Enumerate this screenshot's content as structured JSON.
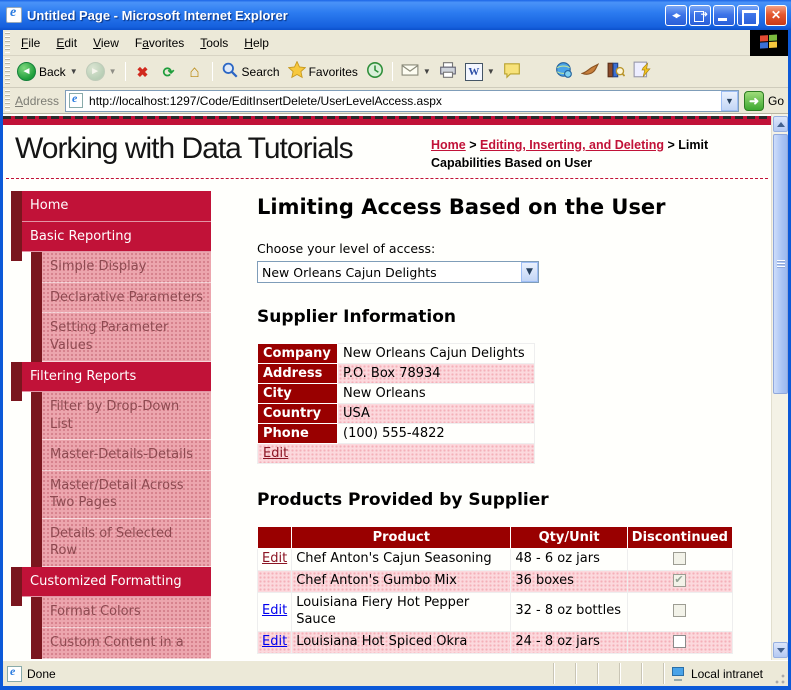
{
  "window": {
    "title": "Untitled Page - Microsoft Internet Explorer"
  },
  "menu_bar": {
    "items": [
      {
        "label": "File",
        "accel": 0
      },
      {
        "label": "Edit",
        "accel": 0
      },
      {
        "label": "View",
        "accel": 0
      },
      {
        "label": "Favorites",
        "accel": 1
      },
      {
        "label": "Tools",
        "accel": 0
      },
      {
        "label": "Help",
        "accel": 0
      }
    ]
  },
  "toolbar": {
    "buttons": [
      {
        "icon": "back-icon",
        "label": "Back",
        "dropdown": true
      },
      {
        "icon": "forward-icon",
        "label": "",
        "dropdown": true,
        "disabled": true
      },
      {
        "sep": true
      },
      {
        "icon": "stop-icon"
      },
      {
        "icon": "refresh-icon"
      },
      {
        "icon": "home-icon"
      },
      {
        "sep": true
      },
      {
        "icon": "search-icon",
        "label": "Search"
      },
      {
        "icon": "favorites-star-icon",
        "label": "Favorites"
      },
      {
        "icon": "history-icon"
      },
      {
        "sep": true
      },
      {
        "icon": "mail-icon",
        "dropdown": true
      },
      {
        "icon": "print-icon"
      },
      {
        "icon": "edit-word-icon",
        "dropdown": true
      },
      {
        "icon": "discuss-icon"
      },
      {
        "gap": true
      },
      {
        "icon": "research-globe-icon"
      },
      {
        "icon": "fox-icon"
      },
      {
        "icon": "library-search-icon"
      },
      {
        "icon": "messenger-grid-icon"
      }
    ]
  },
  "address_bar": {
    "label": "Address",
    "url": "http://localhost:1297/Code/EditInsertDelete/UserLevelAccess.aspx",
    "go_label": "Go"
  },
  "page": {
    "site_title": "Working with Data Tutorials",
    "breadcrumb": [
      {
        "label": "Home",
        "link": true
      },
      {
        "label": "Editing, Inserting, and Deleting",
        "link": true
      },
      {
        "label": "Limit Capabilities Based on User",
        "link": false
      }
    ],
    "sidebar": [
      {
        "label": "Home",
        "level": 0
      },
      {
        "label": "Basic Reporting",
        "level": 0
      },
      {
        "label": "Simple Display",
        "level": 1
      },
      {
        "label": "Declarative Parameters",
        "level": 1
      },
      {
        "label": "Setting Parameter Values",
        "level": 1
      },
      {
        "label": "Filtering Reports",
        "level": 0
      },
      {
        "label": "Filter by Drop-Down List",
        "level": 1
      },
      {
        "label": "Master-Details-Details",
        "level": 1
      },
      {
        "label": "Master/Detail Across Two Pages",
        "level": 1
      },
      {
        "label": "Details of Selected Row",
        "level": 1
      },
      {
        "label": "Customized Formatting",
        "level": 0
      },
      {
        "label": "Format Colors",
        "level": 1
      },
      {
        "label": "Custom Content in a",
        "level": 1
      }
    ],
    "heading": "Limiting Access Based on the User",
    "access_prompt": "Choose your level of access:",
    "access_selected": "New Orleans Cajun Delights",
    "supplier": {
      "heading": "Supplier Information",
      "fields": [
        {
          "label": "Company",
          "value": "New Orleans Cajun Delights"
        },
        {
          "label": "Address",
          "value": "P.O. Box 78934"
        },
        {
          "label": "City",
          "value": "New Orleans"
        },
        {
          "label": "Country",
          "value": "USA"
        },
        {
          "label": "Phone",
          "value": "(100) 555-4822"
        }
      ],
      "edit_label": "Edit"
    },
    "products": {
      "heading": "Products Provided by Supplier",
      "columns": [
        "",
        "Product",
        "Qty/Unit",
        "Discontinued"
      ],
      "rows": [
        {
          "edit": "Edit",
          "edit_color": "maroon",
          "product": "Chef Anton's Cajun Seasoning",
          "qty": "48 - 6 oz jars",
          "discontinued": false,
          "checkbox_disabled": true
        },
        {
          "edit": null,
          "edit_color": null,
          "product": "Chef Anton's Gumbo Mix",
          "qty": "36 boxes",
          "discontinued": true,
          "checkbox_disabled": true
        },
        {
          "edit": "Edit",
          "edit_color": "blue",
          "product": "Louisiana Fiery Hot Pepper Sauce",
          "qty": "32 - 8 oz bottles",
          "discontinued": false,
          "checkbox_disabled": true
        },
        {
          "edit": "Edit",
          "edit_color": "blue",
          "product": "Louisiana Hot Spiced Okra",
          "qty": "24 - 8 oz jars",
          "discontinued": false,
          "checkbox_disabled": false
        }
      ]
    }
  },
  "status_bar": {
    "left": "Done",
    "right": "Local intranet"
  },
  "colors": {
    "accent_red": "#C11238",
    "dark_red_bar": "#7A161E",
    "sidebar_pink": "#ECA6AE",
    "table_header_red": "#990000",
    "row_pink": "#FCD9DD",
    "link_blue": "#0000EE",
    "link_maroon": "#8B1423",
    "title_blue": "#0C59D8"
  }
}
